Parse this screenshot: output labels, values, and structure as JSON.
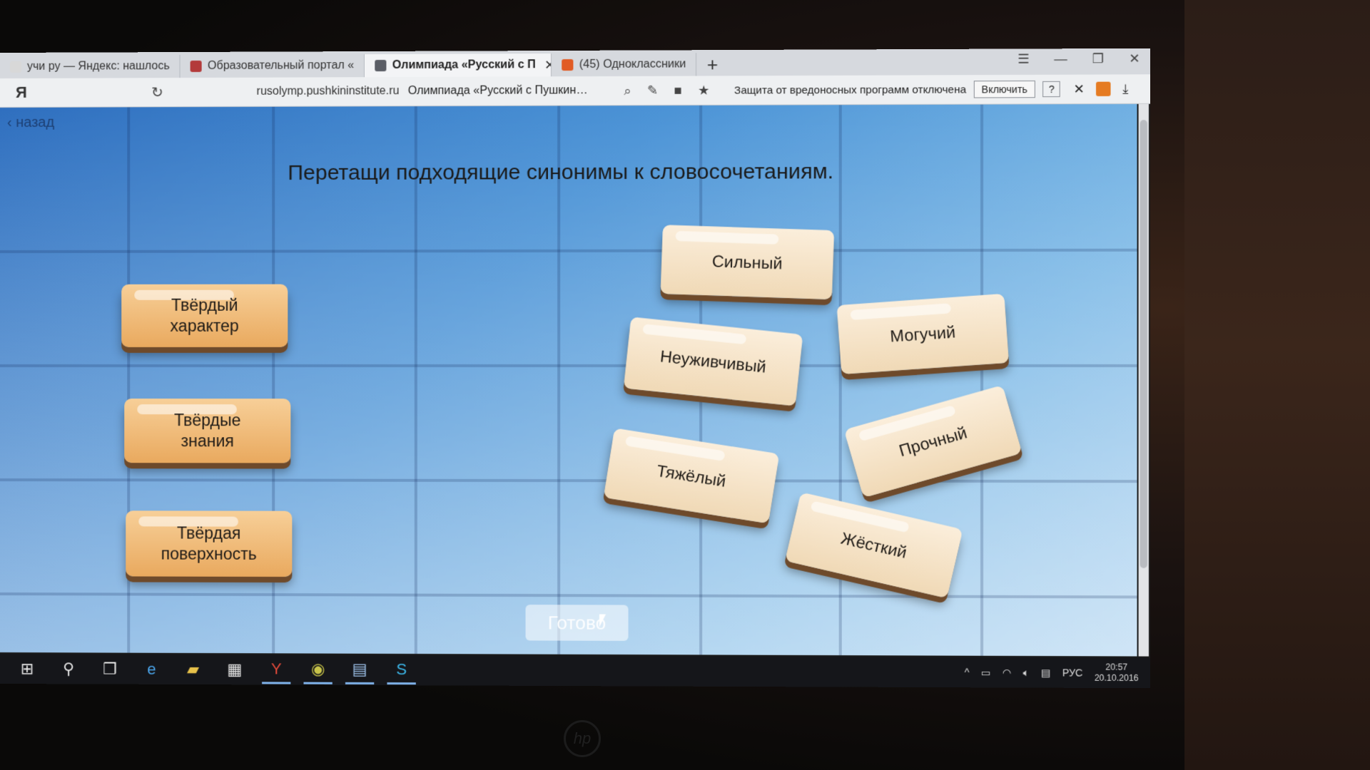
{
  "browser": {
    "tabs": [
      {
        "label": "учи ру — Яндекс: нашлось",
        "fav_color": "#d8d8d8",
        "active": false
      },
      {
        "label": "Образовательный портал «",
        "fav_color": "#b33a3a",
        "active": false
      },
      {
        "label": "Олимпиада «Русский с П",
        "fav_color": "#5b5e66",
        "active": true
      },
      {
        "label": "(45) Одноклассники",
        "fav_color": "#e15b24",
        "active": false
      }
    ],
    "newtab_symbol": "+",
    "window_controls": [
      "☰",
      "—",
      "❐",
      "✕"
    ],
    "ya_logo": "Я",
    "url": "rusolymp.pushkininstitute.ru",
    "page_title": "Олимпиада «Русский с Пушкин…",
    "protection_text": "Защита от вредоносных программ отключена",
    "enable_button": "Включить",
    "help_button": "?",
    "close_symbol": "✕",
    "download_symbol": "⤓"
  },
  "game": {
    "back_label": "назад",
    "instruction": "Перетащи подходящие синонимы к словосочетаниям.",
    "targets": [
      "Твёрдый характер",
      "Твёрдые знания",
      "Твёрдая поверхность"
    ],
    "options": [
      "Сильный",
      "Могучий",
      "Неуживчивый",
      "Прочный",
      "Тяжёлый",
      "Жёсткий"
    ],
    "ready_button": "Готово"
  },
  "taskbar": {
    "language": "РУС",
    "time": "20:57",
    "date": "20.10.2016"
  }
}
